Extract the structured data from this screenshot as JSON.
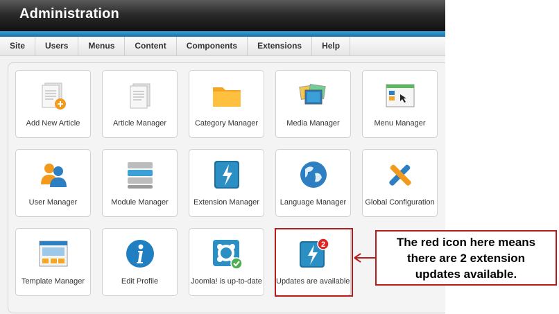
{
  "header": {
    "title": "Administration"
  },
  "menu": [
    {
      "label": "Site"
    },
    {
      "label": "Users"
    },
    {
      "label": "Menus"
    },
    {
      "label": "Content"
    },
    {
      "label": "Components"
    },
    {
      "label": "Extensions"
    },
    {
      "label": "Help"
    }
  ],
  "tiles": [
    {
      "label": "Add New Article",
      "icon": "add-article-icon"
    },
    {
      "label": "Article Manager",
      "icon": "article-icon"
    },
    {
      "label": "Category Manager",
      "icon": "folder-icon"
    },
    {
      "label": "Media Manager",
      "icon": "media-icon"
    },
    {
      "label": "Menu Manager",
      "icon": "menu-icon"
    },
    {
      "label": "User Manager",
      "icon": "users-icon"
    },
    {
      "label": "Module Manager",
      "icon": "module-icon"
    },
    {
      "label": "Extension Manager",
      "icon": "extension-icon"
    },
    {
      "label": "Language Manager",
      "icon": "globe-icon"
    },
    {
      "label": "Global Configuration",
      "icon": "tools-icon"
    },
    {
      "label": "Template Manager",
      "icon": "template-icon"
    },
    {
      "label": "Edit Profile",
      "icon": "info-icon"
    },
    {
      "label": "Joomla! is up-to-date",
      "icon": "joomla-check-icon"
    },
    {
      "label": "Updates are available!",
      "icon": "update-badge-icon",
      "badge": "2"
    }
  ],
  "callout": {
    "text": "The red icon here means there are 2 extension updates available."
  },
  "colors": {
    "accent": "#b51c1c",
    "blue": "#1a6fa8"
  }
}
